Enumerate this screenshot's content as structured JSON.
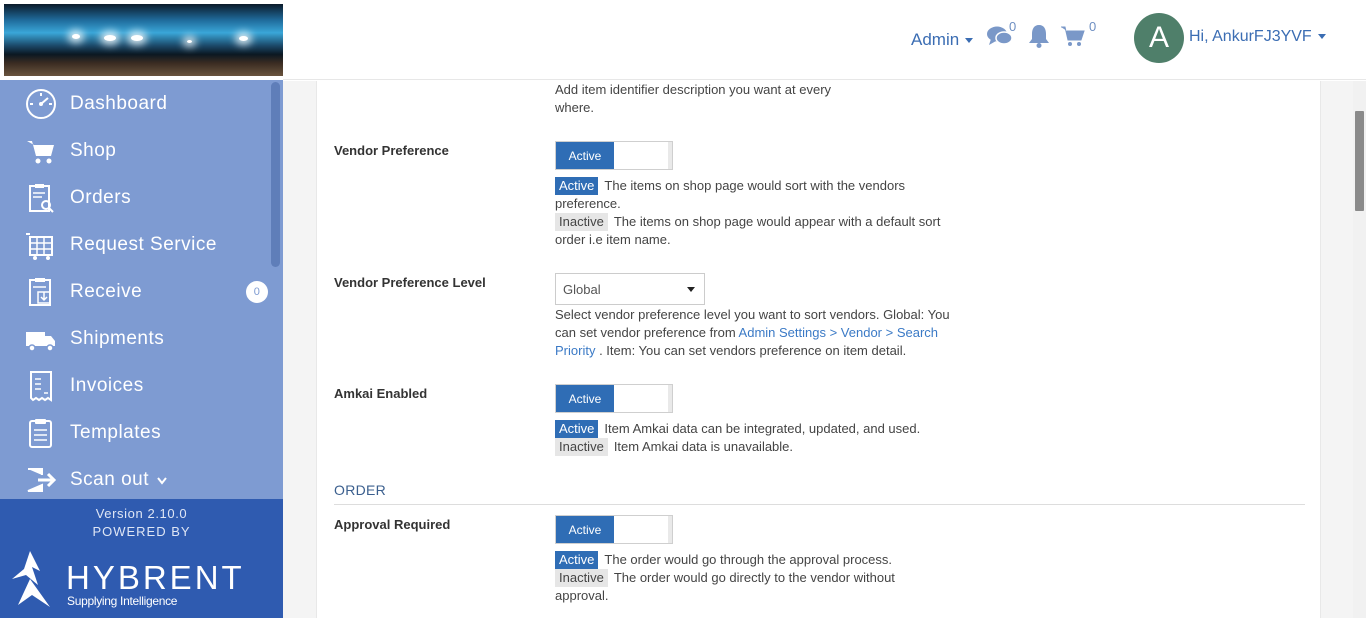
{
  "header": {
    "admin_label": "Admin",
    "messages_count": "0",
    "cart_count": "0",
    "avatar_letter": "A",
    "user_greeting": "Hi, AnkurFJ3YVF"
  },
  "sidebar": {
    "items": [
      {
        "label": "Dashboard",
        "icon": "dashboard-icon"
      },
      {
        "label": "Shop",
        "icon": "cart-icon"
      },
      {
        "label": "Orders",
        "icon": "orders-icon"
      },
      {
        "label": "Request Service",
        "icon": "request-service-icon"
      },
      {
        "label": "Receive",
        "icon": "receive-icon",
        "badge": "0"
      },
      {
        "label": "Shipments",
        "icon": "truck-icon"
      },
      {
        "label": "Invoices",
        "icon": "invoice-icon"
      },
      {
        "label": "Templates",
        "icon": "templates-icon"
      },
      {
        "label": "Scan out",
        "icon": "scan-out-icon"
      }
    ],
    "version": "Version 2.10.0",
    "powered_by": "POWERED BY",
    "brand": "HYBRENT",
    "tagline": "Supplying Intelligence"
  },
  "settings": {
    "identifier_desc_1": "Add item identifier description you want at every",
    "identifier_desc_2": "where.",
    "vendor_pref": {
      "label": "Vendor Preference",
      "toggle": "Active",
      "active_tag": "Active",
      "active_text_1": "The items on shop page would sort with the vendors",
      "active_text_2": "preference.",
      "inactive_tag": "Inactive",
      "inactive_text_1": "The items on shop page would appear with a default sort",
      "inactive_text_2": "order i.e item name."
    },
    "vendor_pref_level": {
      "label": "Vendor Preference Level",
      "selected": "Global",
      "desc_1": "Select vendor preference level you want to sort vendors. Global: You",
      "desc_2a": "can set vendor preference from ",
      "desc_2_link": "Admin Settings > Vendor > Search",
      "desc_3_link": "Priority",
      "desc_3b": " . Item: You can set vendors preference on item detail."
    },
    "amkai": {
      "label": "Amkai Enabled",
      "toggle": "Active",
      "active_tag": "Active",
      "active_text": "Item Amkai data can be integrated, updated, and used.",
      "inactive_tag": "Inactive",
      "inactive_text": "Item Amkai data is unavailable."
    },
    "order_section": "ORDER",
    "approval": {
      "label": "Approval Required",
      "toggle": "Active",
      "active_tag": "Active",
      "active_text": "The order would go through the approval process.",
      "inactive_tag": "Inactive",
      "inactive_text_1": "The order would go directly to the vendor without",
      "inactive_text_2": "approval."
    }
  }
}
